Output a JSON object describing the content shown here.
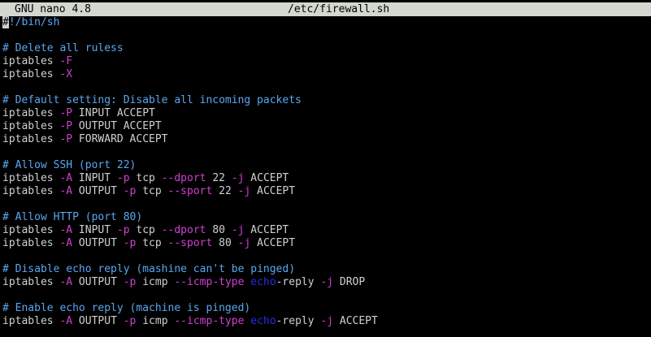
{
  "titlebar": {
    "version": "GNU nano 4.8",
    "filename": "/etc/firewall.sh"
  },
  "colors": {
    "titlebar_bg": "#d3d7cf",
    "text": "#d0d0d0",
    "comment": "#5aa7ef",
    "flag": "#d040d0",
    "keyword": "#2a2ae0",
    "background": "#000000"
  },
  "lines": [
    [
      {
        "t": "#",
        "s": "cursor"
      },
      {
        "t": "!/bin/sh",
        "s": "comment"
      }
    ],
    [],
    [
      {
        "t": "# Delete all ruless",
        "s": "comment"
      }
    ],
    [
      {
        "t": "iptables ",
        "s": "text"
      },
      {
        "t": "-F",
        "s": "flag"
      }
    ],
    [
      {
        "t": "iptables ",
        "s": "text"
      },
      {
        "t": "-X",
        "s": "flag"
      }
    ],
    [],
    [
      {
        "t": "# Default setting: Disable all incoming packets",
        "s": "comment"
      }
    ],
    [
      {
        "t": "iptables ",
        "s": "text"
      },
      {
        "t": "-P",
        "s": "flag"
      },
      {
        "t": " INPUT ACCEPT",
        "s": "text"
      }
    ],
    [
      {
        "t": "iptables ",
        "s": "text"
      },
      {
        "t": "-P",
        "s": "flag"
      },
      {
        "t": " OUTPUT ACCEPT",
        "s": "text"
      }
    ],
    [
      {
        "t": "iptables ",
        "s": "text"
      },
      {
        "t": "-P",
        "s": "flag"
      },
      {
        "t": " FORWARD ACCEPT",
        "s": "text"
      }
    ],
    [],
    [
      {
        "t": "# Allow SSH (port 22)",
        "s": "comment"
      }
    ],
    [
      {
        "t": "iptables ",
        "s": "text"
      },
      {
        "t": "-A",
        "s": "flag"
      },
      {
        "t": " INPUT ",
        "s": "text"
      },
      {
        "t": "-p",
        "s": "flag"
      },
      {
        "t": " tcp ",
        "s": "text"
      },
      {
        "t": "--dport",
        "s": "flag"
      },
      {
        "t": " 22 ",
        "s": "text"
      },
      {
        "t": "-j",
        "s": "flag"
      },
      {
        "t": " ACCEPT",
        "s": "text"
      }
    ],
    [
      {
        "t": "iptables ",
        "s": "text"
      },
      {
        "t": "-A",
        "s": "flag"
      },
      {
        "t": " OUTPUT ",
        "s": "text"
      },
      {
        "t": "-p",
        "s": "flag"
      },
      {
        "t": " tcp ",
        "s": "text"
      },
      {
        "t": "--sport",
        "s": "flag"
      },
      {
        "t": " 22 ",
        "s": "text"
      },
      {
        "t": "-j",
        "s": "flag"
      },
      {
        "t": " ACCEPT",
        "s": "text"
      }
    ],
    [],
    [
      {
        "t": "# Allow HTTP (port 80)",
        "s": "comment"
      }
    ],
    [
      {
        "t": "iptables ",
        "s": "text"
      },
      {
        "t": "-A",
        "s": "flag"
      },
      {
        "t": " INPUT ",
        "s": "text"
      },
      {
        "t": "-p",
        "s": "flag"
      },
      {
        "t": " tcp ",
        "s": "text"
      },
      {
        "t": "--dport",
        "s": "flag"
      },
      {
        "t": " 80 ",
        "s": "text"
      },
      {
        "t": "-j",
        "s": "flag"
      },
      {
        "t": " ACCEPT",
        "s": "text"
      }
    ],
    [
      {
        "t": "iptables ",
        "s": "text"
      },
      {
        "t": "-A",
        "s": "flag"
      },
      {
        "t": " OUTPUT ",
        "s": "text"
      },
      {
        "t": "-p",
        "s": "flag"
      },
      {
        "t": " tcp ",
        "s": "text"
      },
      {
        "t": "--sport",
        "s": "flag"
      },
      {
        "t": " 80 ",
        "s": "text"
      },
      {
        "t": "-j",
        "s": "flag"
      },
      {
        "t": " ACCEPT",
        "s": "text"
      }
    ],
    [],
    [
      {
        "t": "# Disable echo reply (mashine can't be pinged)",
        "s": "comment"
      }
    ],
    [
      {
        "t": "iptables ",
        "s": "text"
      },
      {
        "t": "-A",
        "s": "flag"
      },
      {
        "t": " OUTPUT ",
        "s": "text"
      },
      {
        "t": "-p",
        "s": "flag"
      },
      {
        "t": " icmp ",
        "s": "text"
      },
      {
        "t": "--icmp-type",
        "s": "flag"
      },
      {
        "t": " ",
        "s": "text"
      },
      {
        "t": "echo",
        "s": "kw"
      },
      {
        "t": "-reply ",
        "s": "text"
      },
      {
        "t": "-j",
        "s": "flag"
      },
      {
        "t": " DROP",
        "s": "text"
      }
    ],
    [],
    [
      {
        "t": "# Enable echo reply (machine is pinged)",
        "s": "comment"
      }
    ],
    [
      {
        "t": "iptables ",
        "s": "text"
      },
      {
        "t": "-A",
        "s": "flag"
      },
      {
        "t": " OUTPUT ",
        "s": "text"
      },
      {
        "t": "-p",
        "s": "flag"
      },
      {
        "t": " icmp ",
        "s": "text"
      },
      {
        "t": "--icmp-type",
        "s": "flag"
      },
      {
        "t": " ",
        "s": "text"
      },
      {
        "t": "echo",
        "s": "kw"
      },
      {
        "t": "-reply ",
        "s": "text"
      },
      {
        "t": "-j",
        "s": "flag"
      },
      {
        "t": " ACCEPT",
        "s": "text"
      }
    ]
  ]
}
